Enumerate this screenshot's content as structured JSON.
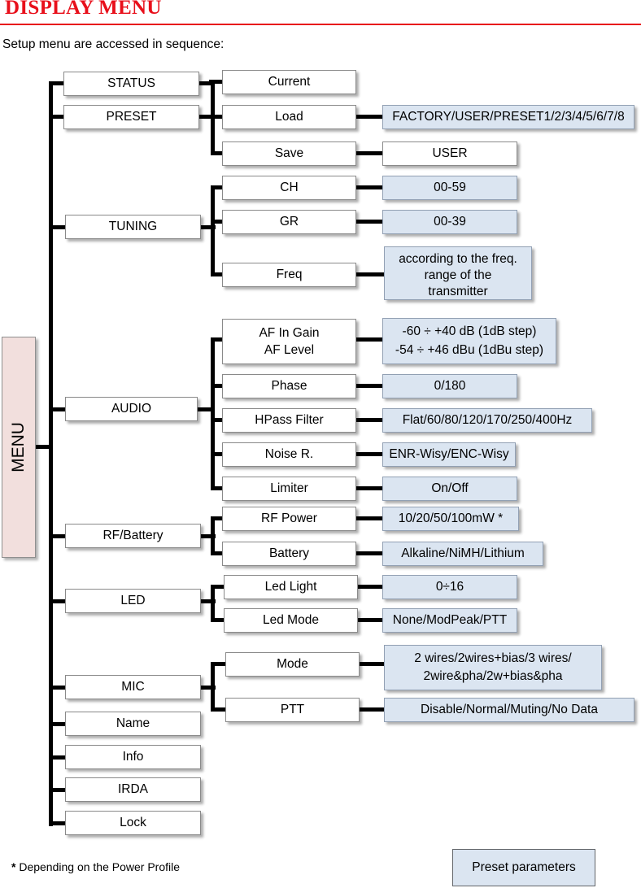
{
  "header": {
    "title": "DISPLAY MENU",
    "subtitle": "Setup menu are accessed in sequence:",
    "title_color": "#e8101b",
    "rule_color": "#e8101b"
  },
  "root": {
    "label": "MENU",
    "color": "#f2dfdd"
  },
  "colors": {
    "value_box_fill": "#dbe5f1",
    "value_box_border": "#92a0b3",
    "menu_box_fill": "#f2dfdd",
    "box_fill": "#ffffff",
    "box_border": "#8a8a8a",
    "connector": "#000000"
  },
  "level1": [
    {
      "label": "STATUS"
    },
    {
      "label": "PRESET"
    },
    {
      "label": "TUNING"
    },
    {
      "label": "AUDIO"
    },
    {
      "label": "RF/Battery"
    },
    {
      "label": "LED"
    },
    {
      "label": "MIC"
    },
    {
      "label": "Name"
    },
    {
      "label": "Info"
    },
    {
      "label": "IRDA"
    },
    {
      "label": "Lock"
    }
  ],
  "level2": [
    {
      "label": "Current"
    },
    {
      "label": "Load"
    },
    {
      "label": "Save"
    },
    {
      "label": "CH"
    },
    {
      "label": "GR"
    },
    {
      "label": "Freq"
    },
    {
      "label_line1": "AF In Gain",
      "label_line2": "AF Level"
    },
    {
      "label": "Phase"
    },
    {
      "label": "HPass Filter"
    },
    {
      "label": "Noise R."
    },
    {
      "label": "Limiter"
    },
    {
      "label": "RF Power"
    },
    {
      "label": "Battery"
    },
    {
      "label": "Led Light"
    },
    {
      "label": "Led Mode"
    },
    {
      "label": "Mode"
    },
    {
      "label": "PTT"
    }
  ],
  "values": {
    "preset_load": "FACTORY/USER/PRESET1/2/3/4/5/6/7/8",
    "preset_save": "USER",
    "tuning_ch": "00-59",
    "tuning_gr": "00-39",
    "tuning_freq_line1": "according to the freq.",
    "tuning_freq_line2": "range of the",
    "tuning_freq_line3": "transmitter",
    "audio_af_line1": "-60 ÷ +40 dB (1dB step)",
    "audio_af_line2": "-54 ÷ +46 dBu (1dBu step)",
    "audio_phase": "0/180",
    "audio_hpass": "Flat/60/80/120/170/250/400Hz",
    "audio_noise": "ENR-Wisy/ENC-Wisy",
    "audio_limiter": "On/Off",
    "rf_power": "10/20/50/100mW *",
    "battery": "Alkaline/NiMH/Lithium",
    "led_light": "0÷16",
    "led_mode": "None/ModPeak/PTT",
    "mic_mode_line1": "2 wires/2wires+bias/3 wires/",
    "mic_mode_line2": "2wire&pha/2w+bias&pha",
    "mic_ptt": "Disable/Normal/Muting/No Data"
  },
  "footer": {
    "note_star": "*",
    "note_text": " Depending on the Power Profile",
    "legend_label": "Preset parameters"
  }
}
